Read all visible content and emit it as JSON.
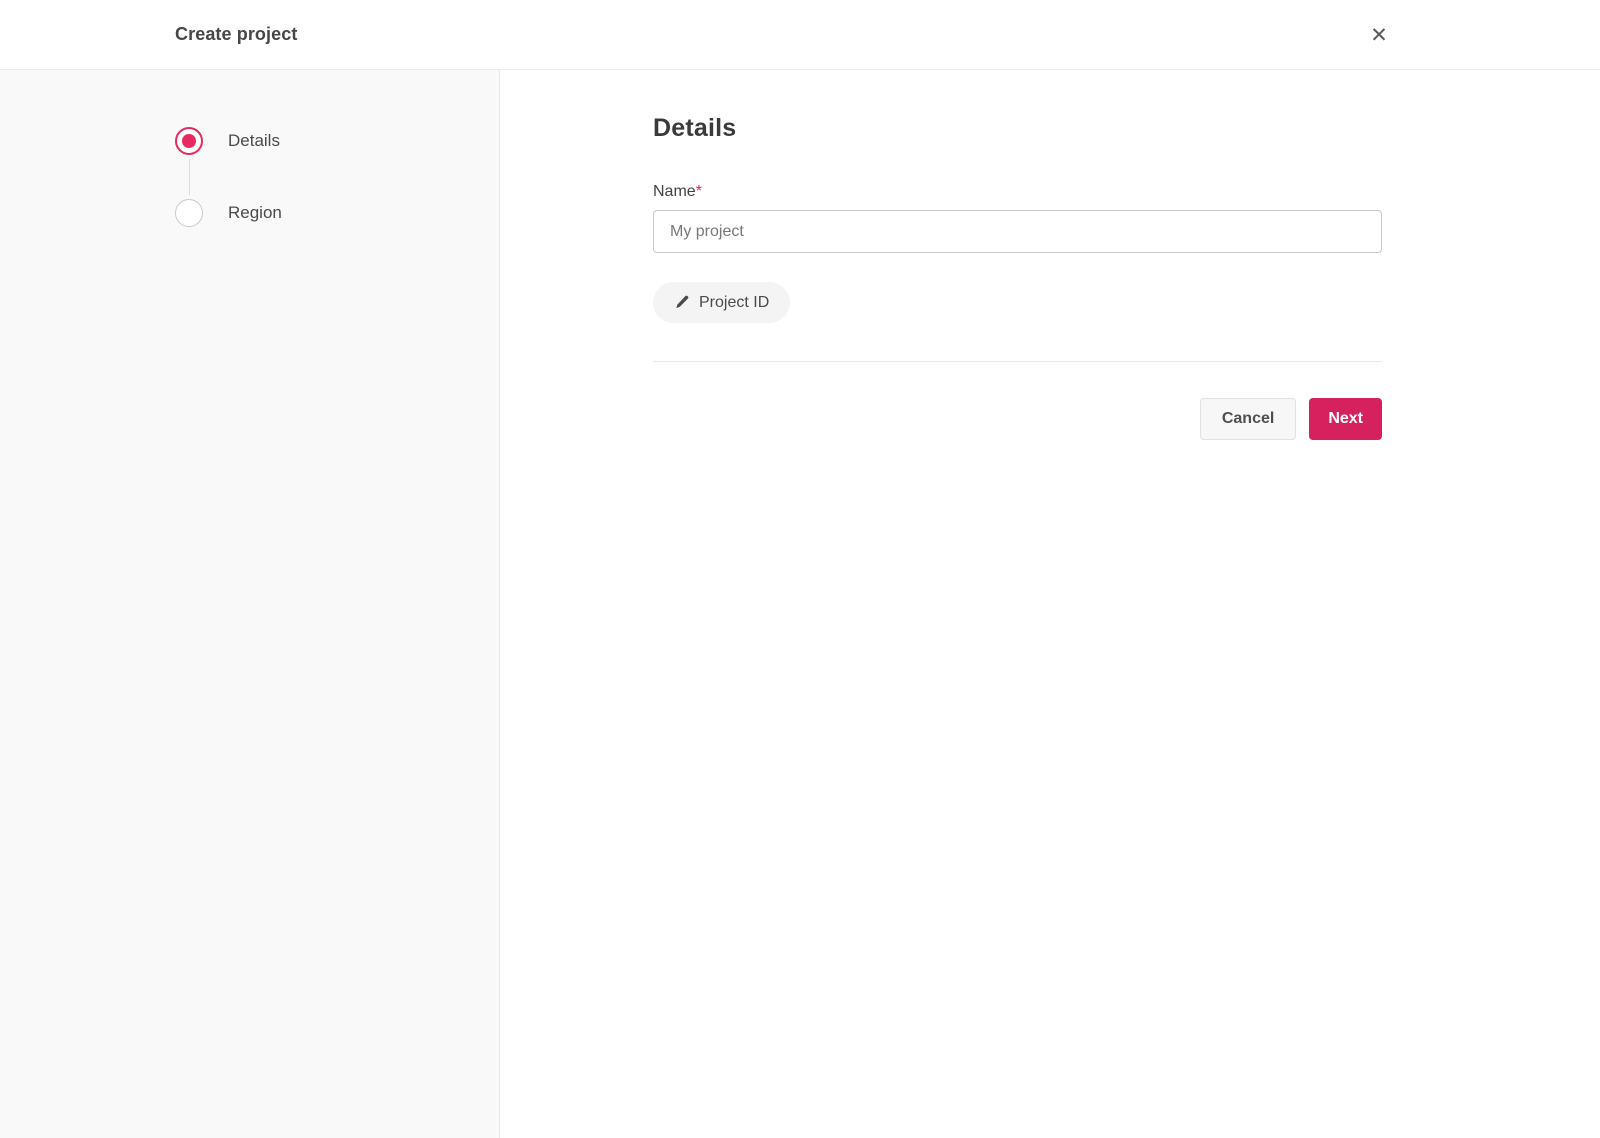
{
  "header": {
    "title": "Create project",
    "close_icon": "✕"
  },
  "stepper": {
    "steps": [
      {
        "label": "Details",
        "state": "active"
      },
      {
        "label": "Region",
        "state": "inactive"
      }
    ]
  },
  "main": {
    "heading": "Details",
    "name_field": {
      "label": "Name",
      "required_marker": "*",
      "value": "",
      "placeholder": "My project"
    },
    "project_id_button": {
      "icon": "pencil-icon",
      "label": "Project ID"
    }
  },
  "footer": {
    "cancel_label": "Cancel",
    "next_label": "Next"
  },
  "colors": {
    "accent_button": "#d6215f",
    "stepper_active": "#e7295e",
    "required_asterisk": "#e5254f",
    "sidebar_background": "#f9f9fa"
  }
}
